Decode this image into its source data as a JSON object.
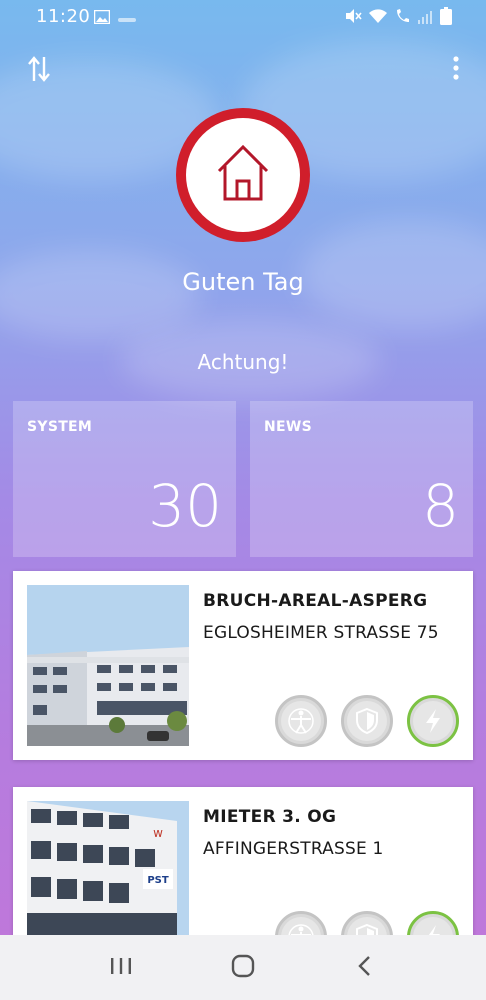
{
  "status_bar": {
    "time": "11:20",
    "left_icons": [
      "image-icon",
      "notification-icon"
    ],
    "right_icons": [
      "mute-icon",
      "wifi-icon",
      "wifi-call-icon",
      "signal-icon",
      "battery-icon"
    ]
  },
  "top_actions": {
    "sort_icon": "sort-arrows-icon",
    "menu_icon": "more-vertical-icon"
  },
  "header": {
    "badge_icon": "home-icon",
    "greeting": "Guten Tag",
    "warning": "Achtung!"
  },
  "tiles": [
    {
      "label": "SYSTEM",
      "count": "30"
    },
    {
      "label": "NEWS",
      "count": "8"
    }
  ],
  "properties": [
    {
      "title": "BRUCH-AREAL-ASPERG",
      "address": "EGLOSHEIMER STRASSE 75",
      "statuses": [
        {
          "icon": "person-vitruvian-icon",
          "state": "inactive"
        },
        {
          "icon": "shield-icon",
          "state": "inactive"
        },
        {
          "icon": "lightning-icon",
          "state": "ok"
        }
      ]
    },
    {
      "title": "MIETER 3. OG",
      "address": "AFFINGERSTRASSE 1",
      "image_sign": "PST",
      "statuses": [
        {
          "icon": "person-vitruvian-icon",
          "state": "inactive"
        },
        {
          "icon": "shield-icon",
          "state": "inactive"
        },
        {
          "icon": "lightning-icon",
          "state": "ok"
        }
      ]
    }
  ],
  "colors": {
    "brand_red": "#d01e2b",
    "ok_green": "#7cc243",
    "gradient_top": "#78b9ee",
    "gradient_bottom": "#c276d9"
  },
  "nav_bar": {
    "recent_icon": "recent-apps-icon",
    "home_icon": "home-circle-icon",
    "back_icon": "back-icon"
  }
}
